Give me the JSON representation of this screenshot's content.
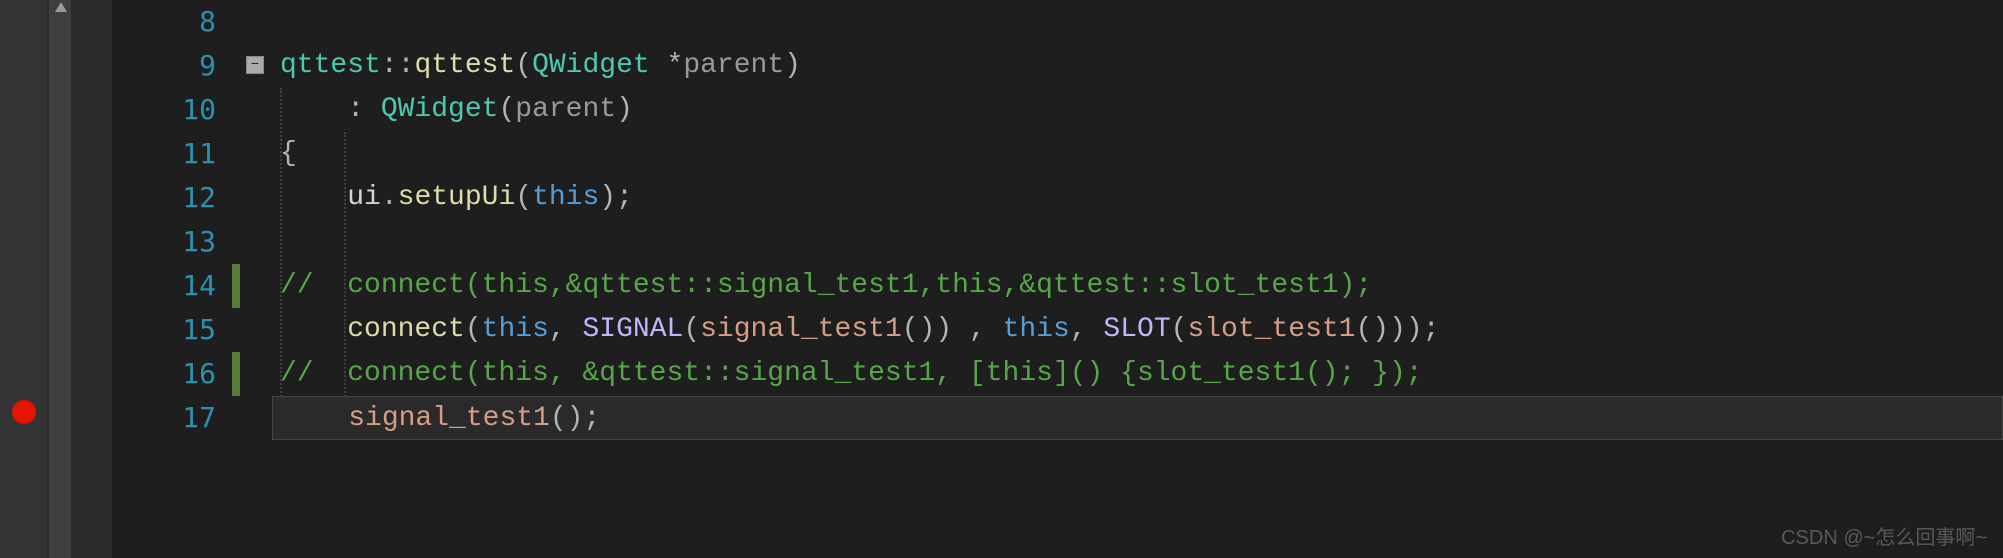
{
  "gutter": {
    "lines": [
      "8",
      "9",
      "10",
      "11",
      "12",
      "13",
      "14",
      "15",
      "16",
      "17"
    ]
  },
  "code": {
    "l9": {
      "a": "qttest",
      "b": "::",
      "c": "qttest",
      "d": "(",
      "e": "QWidget",
      "f": " *",
      "g": "parent",
      "h": ")"
    },
    "l10": {
      "a": ": ",
      "b": "QWidget",
      "c": "(",
      "d": "parent",
      "e": ")"
    },
    "l11": {
      "a": "{"
    },
    "l12": {
      "a": "ui",
      "b": ".",
      "c": "setupUi",
      "d": "(",
      "e": "this",
      "f": ");"
    },
    "l14": {
      "a": "//  connect(this,&qttest::signal_test1,this,&qttest::slot_test1);"
    },
    "l15": {
      "a": "connect",
      "b": "(",
      "c": "this",
      "d": ", ",
      "e": "SIGNAL",
      "f": "(",
      "g": "signal_test1",
      "h": "()) , ",
      "i": "this",
      "j": ", ",
      "k": "SLOT",
      "l": "(",
      "m": "slot_test1",
      "n": "()));"
    },
    "l16": {
      "a": "//  connect(this, &qttest::signal_test1, [this]() {slot_test1(); });"
    },
    "l17": {
      "a": "signal_test1",
      "b": "();"
    }
  },
  "watermark": "CSDN @~怎么回事啊~",
  "breakpoint_line": 17,
  "fold_minus": "−"
}
